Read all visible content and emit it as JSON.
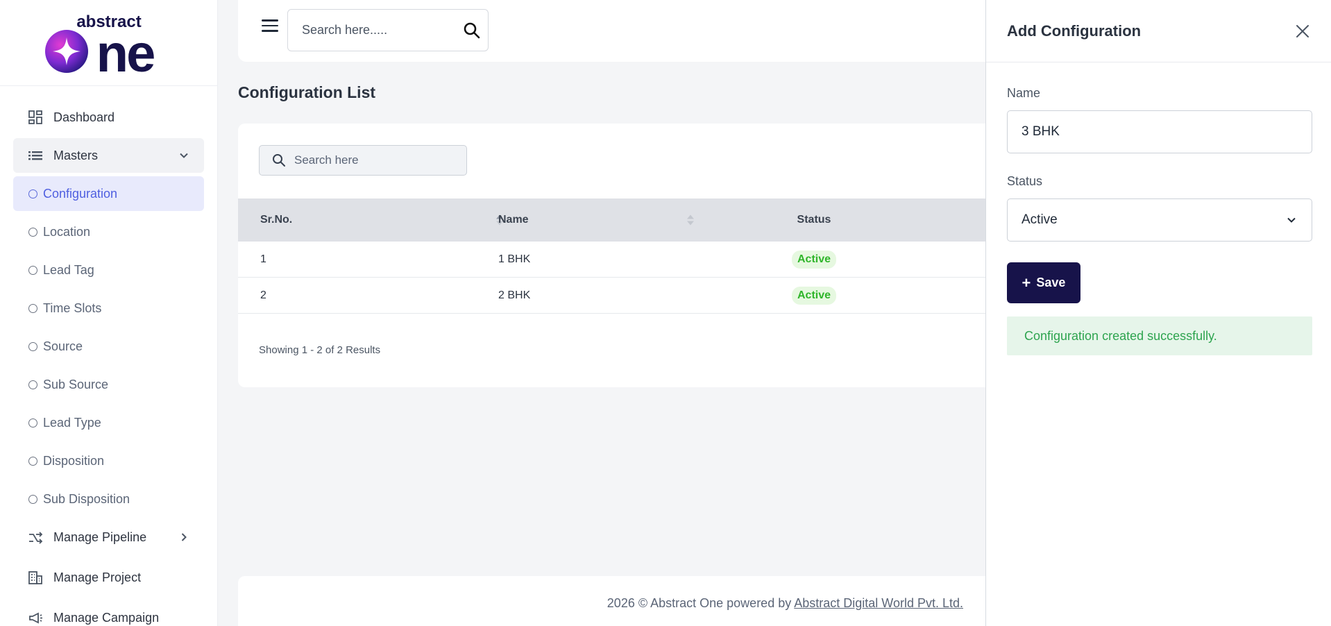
{
  "brand": {
    "logo_text_small": "abstract",
    "logo_text_large": "one"
  },
  "sidebar": {
    "dashboard": "Dashboard",
    "masters": "Masters",
    "sub_items": [
      "Configuration",
      "Location",
      "Lead Tag",
      "Time Slots",
      "Source",
      "Sub Source",
      "Lead Type",
      "Disposition",
      "Sub Disposition"
    ],
    "manage_pipeline": "Manage Pipeline",
    "manage_project": "Manage Project",
    "manage_campaign": "Manage Campaign"
  },
  "topbar": {
    "search_placeholder": "Search here....."
  },
  "main": {
    "title": "Configuration List",
    "search_placeholder": "Search here",
    "columns": [
      "Sr.No.",
      "Name",
      "Status"
    ],
    "rows": [
      {
        "sr": "1",
        "name": "1 BHK",
        "status": "Active"
      },
      {
        "sr": "2",
        "name": "2 BHK",
        "status": "Active"
      }
    ],
    "showing": "Showing 1 - 2 of 2 Results"
  },
  "footer": {
    "text": "2026 © Abstract One powered by",
    "link": "Abstract Digital World Pvt. Ltd."
  },
  "drawer": {
    "title": "Add Configuration",
    "name_label": "Name",
    "name_value": "3 BHK",
    "status_label": "Status",
    "status_value": "Active",
    "save_label": "Save",
    "alert": "Configuration created successfully."
  },
  "colors": {
    "primary": "#17134a",
    "active_nav": "#4f5fe0",
    "success": "#2fb52a"
  }
}
